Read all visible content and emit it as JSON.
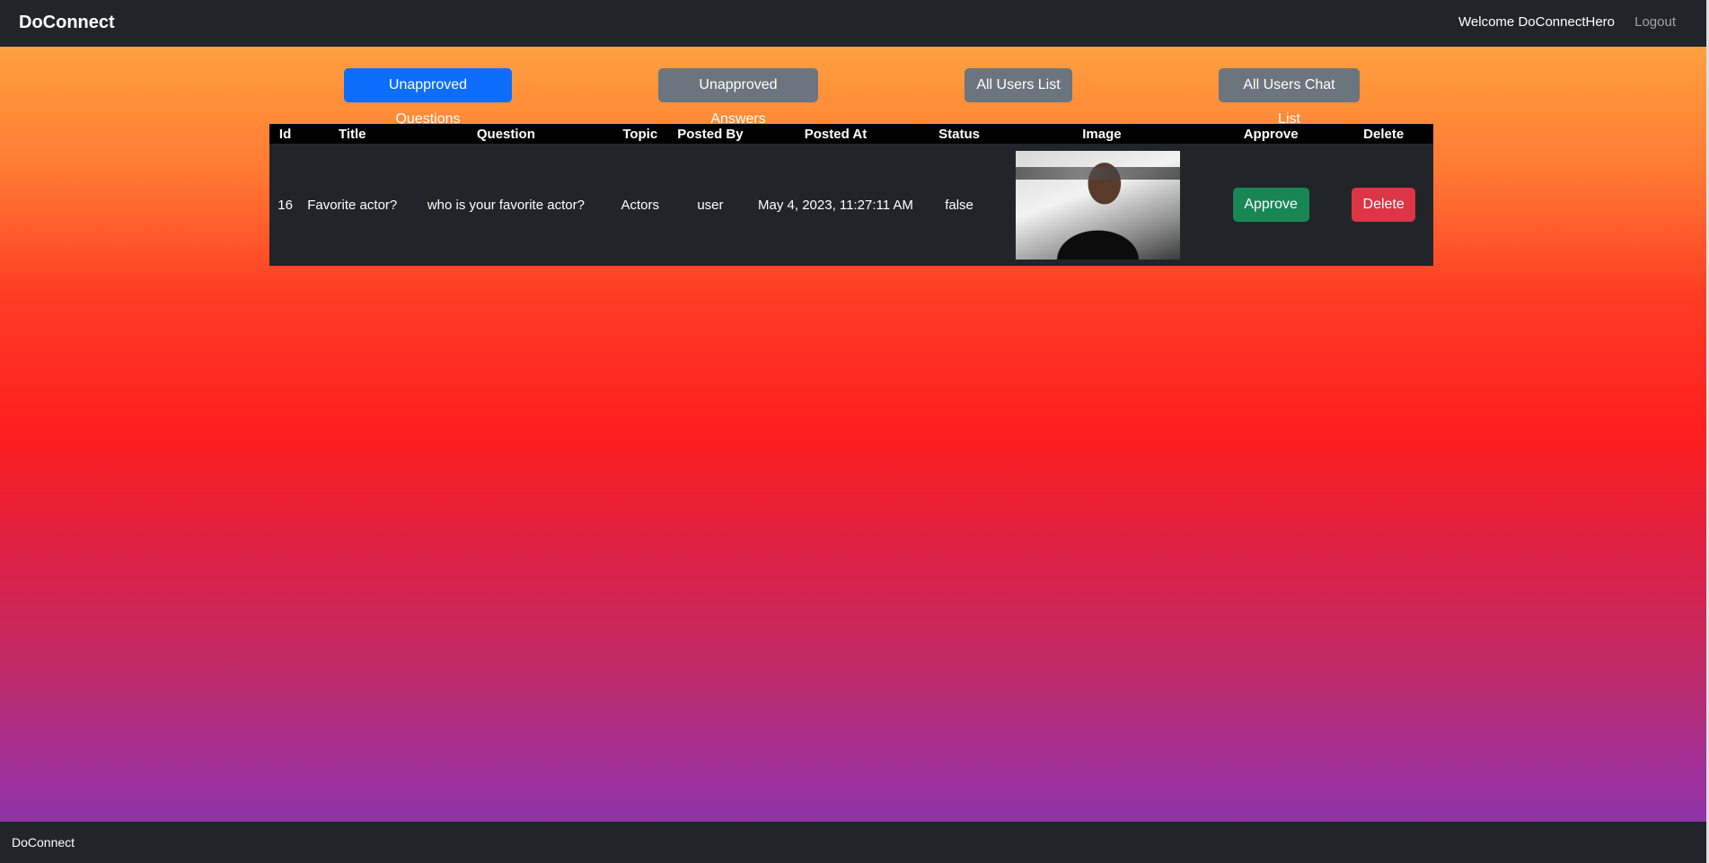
{
  "navbar": {
    "brand": "DoConnect",
    "welcome": "Welcome DoConnectHero",
    "logout": "Logout"
  },
  "tabs": [
    {
      "label": "Unapproved Questions",
      "active": true
    },
    {
      "label": "Unapproved Answers",
      "active": false
    },
    {
      "label": "All Users List",
      "active": false
    },
    {
      "label": "All Users Chat List",
      "active": false
    }
  ],
  "table": {
    "headers": [
      "Id",
      "Title",
      "Question",
      "Topic",
      "Posted By",
      "Posted At",
      "Status",
      "Image",
      "Approve",
      "Delete"
    ],
    "rows": [
      {
        "id": "16",
        "title": "Favorite actor?",
        "question": "who is your favorite actor?",
        "topic": "Actors",
        "posted_by": "user",
        "posted_at": "May 4, 2023, 11:27:11 AM",
        "status": "false",
        "approve_label": "Approve",
        "delete_label": "Delete"
      }
    ]
  },
  "footer": {
    "text": "DoConnect"
  },
  "colors": {
    "navbar": "#212529",
    "primary": "#0d6efd",
    "secondary": "#6c757d",
    "success": "#198754",
    "danger": "#dc3545"
  }
}
